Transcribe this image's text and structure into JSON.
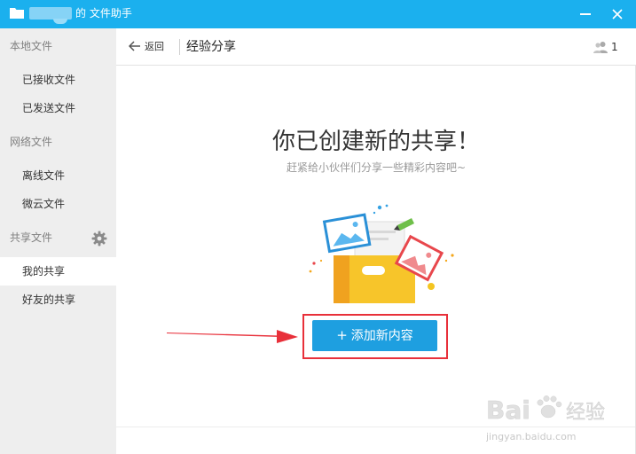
{
  "window": {
    "title": "的 文件助手",
    "accent_color": "#1bb0ee"
  },
  "sidebar": {
    "sections": [
      {
        "label": "本地文件",
        "items": [
          {
            "label": "已接收文件"
          },
          {
            "label": "已发送文件"
          }
        ]
      },
      {
        "label": "网络文件",
        "items": [
          {
            "label": "离线文件"
          },
          {
            "label": "微云文件"
          }
        ]
      },
      {
        "label": "共享文件",
        "items": [
          {
            "label": "我的共享",
            "active": true
          },
          {
            "label": "好友的共享"
          }
        ]
      }
    ]
  },
  "header": {
    "back_label": "返回",
    "title": "经验分享",
    "member_count": "1"
  },
  "main": {
    "empty_title": "你已创建新的共享！",
    "empty_subtitle": "赶紧给小伙伴们分享一些精彩内容吧~",
    "add_button_label": "添加新内容",
    "add_button_icon": "+",
    "button_color": "#1e9fe0",
    "highlight_color": "#e8303a"
  },
  "watermark": {
    "brand": "Bai",
    "brand_tail": "经验",
    "url": "jingyan.baidu.com"
  }
}
